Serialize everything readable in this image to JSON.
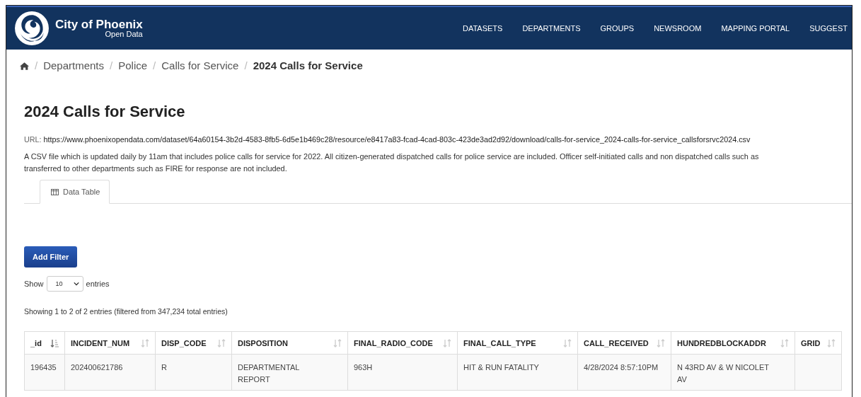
{
  "site": {
    "name": "City of Phoenix",
    "subtitle": "Open Data"
  },
  "nav": [
    "DATASETS",
    "DEPARTMENTS",
    "GROUPS",
    "NEWSROOM",
    "MAPPING PORTAL",
    "SUGGEST"
  ],
  "breadcrumb_separator": "/",
  "breadcrumb": [
    "Departments",
    "Police",
    "Calls for Service",
    "2024 Calls for Service"
  ],
  "title": "2024 Calls for Service",
  "url": {
    "label": "URL:",
    "value": "https://www.phoenixopendata.com/dataset/64a60154-3b2d-4583-8fb5-6d5e1b469c28/resource/e8417a83-fcad-4cad-803c-423de3ad2d92/download/calls-for-service_2024-calls-for-service_callsforsrvc2024.csv"
  },
  "description_lines": [
    "A CSV file which is updated daily by 11am that includes police calls for service for 2022. All citizen-generated dispatched calls for police service are included. Officer self-initiated calls and non dispatched calls such as",
    "transferred to other departments such as FIRE for response are not included."
  ],
  "tabs": [
    {
      "label": "Data Table",
      "selected": true
    }
  ],
  "add_filter": "Add Filter",
  "length": {
    "before": "Show",
    "value": "10",
    "after": "entries"
  },
  "info": "Showing 1 to 2 of 2 entries (filtered from 347,234 total entries)",
  "table": {
    "columns": [
      {
        "label": "_id",
        "sorted": true
      },
      {
        "label": "INCIDENT_NUM",
        "sorted": false
      },
      {
        "label": "DISP_CODE",
        "sorted": false
      },
      {
        "label": "DISPOSITION",
        "sorted": false
      },
      {
        "label": "FINAL_RADIO_CODE",
        "sorted": false
      },
      {
        "label": "FINAL_CALL_TYPE",
        "sorted": false
      },
      {
        "label": "CALL_RECEIVED",
        "sorted": false
      },
      {
        "label": "HUNDREDBLOCKADDR",
        "sorted": false
      },
      {
        "label": "GRID",
        "sorted": false
      }
    ],
    "rows": [
      [
        "196435",
        "202400621786",
        "R",
        "DEPARTMENTAL REPORT",
        "963H",
        "HIT & RUN FATALITY",
        "4/28/2024 8:57:10PM",
        "N 43RD AV & W NICOLET AV",
        null
      ]
    ]
  }
}
